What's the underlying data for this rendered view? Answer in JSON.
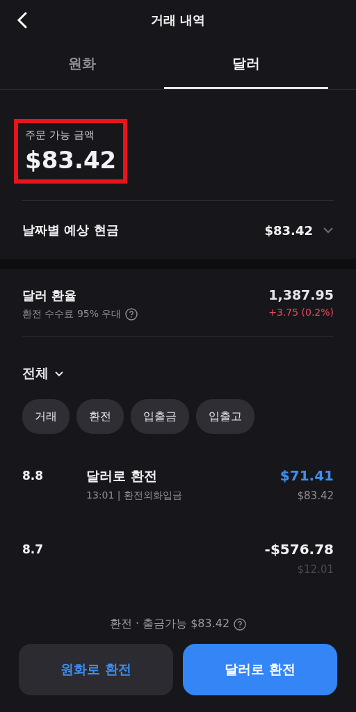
{
  "header": {
    "title": "거래 내역"
  },
  "tabs": [
    {
      "label": "원화",
      "selected": false
    },
    {
      "label": "달러",
      "selected": true
    }
  ],
  "balance": {
    "label": "주문 가능 금액",
    "amount": "$83.42",
    "highlighted": true
  },
  "expected_cash": {
    "label": "날짜별 예상 현금",
    "amount": "$83.42",
    "expanded": false
  },
  "exchange_rate": {
    "label": "달러 환율",
    "note": "환전 수수료 95% 우대",
    "rate": "1,387.95",
    "change": "+3.75 (0.2%)"
  },
  "filter": {
    "label": "전체",
    "chips": [
      {
        "label": "거래"
      },
      {
        "label": "환전"
      },
      {
        "label": "입출금"
      },
      {
        "label": "입출고"
      }
    ]
  },
  "transactions": [
    {
      "date": "8.8",
      "title": "달러로 환전",
      "detail": "13:01 | 환전외화입금",
      "amount": "$71.41",
      "color": "#3d8ef0",
      "balance": "$83.42"
    },
    {
      "date": "8.7",
      "amount": "-$576.78",
      "color": "#f2f2f4",
      "balance": "$12.01"
    }
  ],
  "footer_note": "환전 · 출금가능 $83.42",
  "buttons": [
    {
      "label": "원화로 환전",
      "kind": "secondary"
    },
    {
      "label": "달러로 환전",
      "kind": "primary"
    }
  ]
}
